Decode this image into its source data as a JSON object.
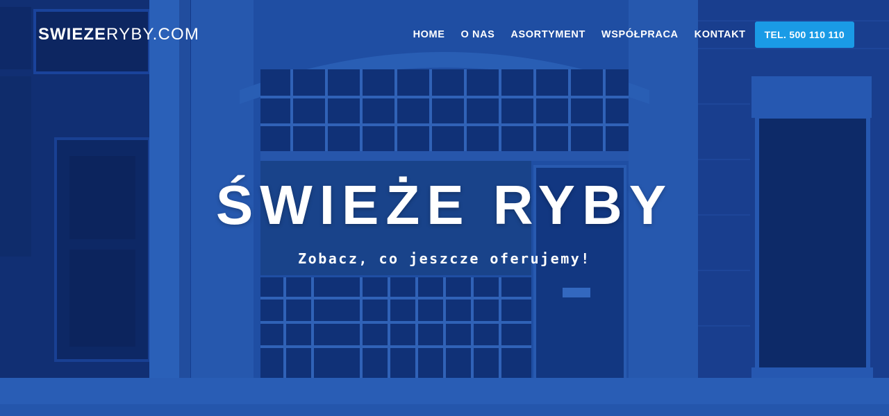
{
  "header": {
    "logo": {
      "bold": "SWIEZE",
      "light": "RYBY.COM"
    },
    "nav": [
      {
        "label": "HOME"
      },
      {
        "label": "O NAS"
      },
      {
        "label": "ASORTYMENT"
      },
      {
        "label": "WSPÓŁPRACA"
      },
      {
        "label": "KONTAKT"
      }
    ],
    "phone_button": "TEL. 500 110 110"
  },
  "hero": {
    "title": "ŚWIEŻE RYBY",
    "subtitle": "Zobacz, co jeszcze oferujemy!"
  },
  "colors": {
    "background_tint": "#143a84",
    "accent_button": "#1a9be6",
    "text": "#ffffff"
  }
}
